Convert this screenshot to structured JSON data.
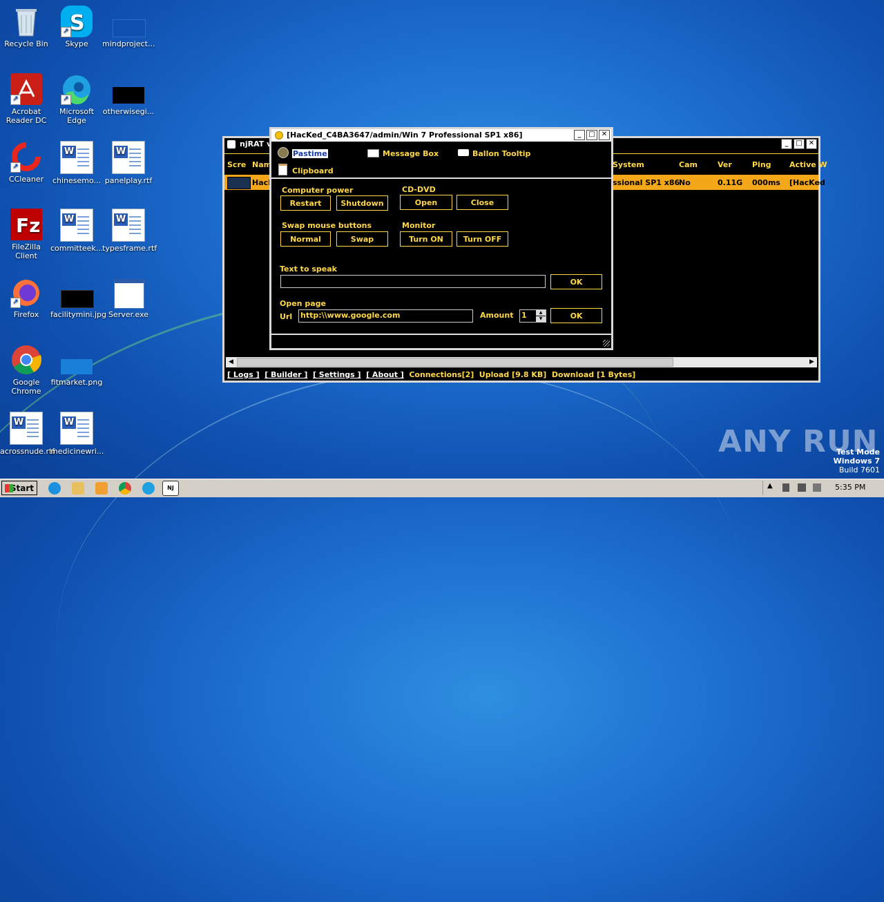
{
  "desktop": {
    "icons": [
      {
        "label": "Recycle Bin"
      },
      {
        "label": "Skype"
      },
      {
        "label": "mindproject..."
      },
      {
        "label": "Acrobat Reader DC"
      },
      {
        "label": "Microsoft Edge"
      },
      {
        "label": "otherwisegi..."
      },
      {
        "label": "CCleaner"
      },
      {
        "label": "chinesemo..."
      },
      {
        "label": "panelplay.rtf"
      },
      {
        "label": "FileZilla Client"
      },
      {
        "label": "committeek..."
      },
      {
        "label": "typesframe.rtf"
      },
      {
        "label": "Firefox"
      },
      {
        "label": "facilitymini.jpg"
      },
      {
        "label": "Server.exe"
      },
      {
        "label": "Google Chrome"
      },
      {
        "label": "fitmarket.png"
      },
      {
        "label": "acrossnude.rtf"
      },
      {
        "label": "medicinewri..."
      }
    ],
    "watermark": {
      "brand": "ANY RUN",
      "lines": [
        "Test Mode",
        "Windows 7",
        "Build 7601"
      ]
    }
  },
  "njrat": {
    "title": "njRAT v",
    "columns": [
      "Scre",
      "Nam",
      "System",
      "Cam",
      "Ver",
      "Ping",
      "Active W"
    ],
    "row": {
      "name": "HacK",
      "system": "ssional SP1 x86",
      "cam": "No",
      "ver": "0.11G",
      "ping": "000ms",
      "active": "[HacKed"
    },
    "status": {
      "logs": "[ Logs ]",
      "builder": "[ Builder ]",
      "settings": "[ Settings ]",
      "about": "[ About ]",
      "connections": "Connections[2]",
      "upload": "Upload [9.8 KB]",
      "download": "Download [1 Bytes]"
    }
  },
  "fun": {
    "title": "[HacKed_C4BA3647/admin/Win 7 Professional SP1 x86]",
    "menu": {
      "pastime": "Pastime",
      "message_box": "Message Box",
      "ballon_tooltip": "Ballon Tooltip",
      "clipboard": "Clipboard"
    },
    "computer_power": {
      "label": "Computer power",
      "restart": "Restart",
      "shutdown": "Shutdown"
    },
    "cd_dvd": {
      "label": "CD-DVD",
      "open": "Open",
      "close": "Close"
    },
    "swap_mouse": {
      "label": "Swap mouse buttons",
      "normal": "Normal",
      "swap": "Swap"
    },
    "monitor": {
      "label": "Monitor",
      "on": "Turn ON",
      "off": "Turn OFF"
    },
    "speak": {
      "label": "Text to speak",
      "value": "",
      "ok": "OK"
    },
    "open_page": {
      "label": "Open page",
      "url_label": "Url",
      "url": "http:\\\\www.google.com",
      "amount_label": "Amount",
      "amount": "1",
      "ok": "OK"
    }
  },
  "taskbar": {
    "start": "Start",
    "time": "5:35 PM"
  }
}
